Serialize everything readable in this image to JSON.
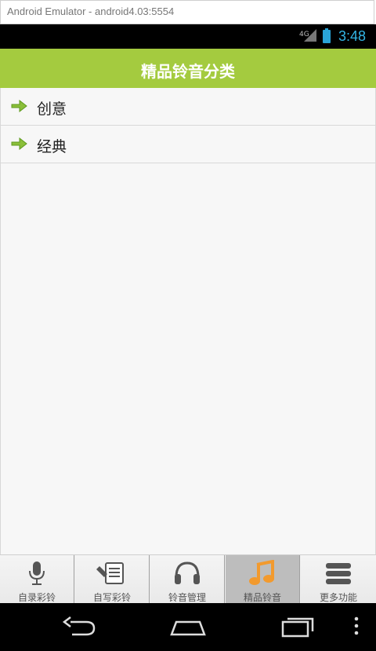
{
  "window": {
    "title": "Android Emulator - android4.03:5554"
  },
  "status_bar": {
    "network": "4G",
    "time": "3:48"
  },
  "header": {
    "title": "精品铃音分类"
  },
  "list": {
    "items": [
      {
        "label": "创意",
        "icon": "arrow-right-icon"
      },
      {
        "label": "经典",
        "icon": "arrow-right-icon"
      }
    ]
  },
  "tabs": [
    {
      "label": "自录彩铃",
      "icon": "microphone-icon",
      "active": false
    },
    {
      "label": "自写彩铃",
      "icon": "document-edit-icon",
      "active": false
    },
    {
      "label": "铃音管理",
      "icon": "headphones-icon",
      "active": false
    },
    {
      "label": "精品铃音",
      "icon": "music-note-icon",
      "active": true
    },
    {
      "label": "更多功能",
      "icon": "more-list-icon",
      "active": false
    }
  ],
  "colors": {
    "header": "#a4cb3f",
    "accent_time": "#33b5e5",
    "active_tab_icon": "#f29a2e"
  }
}
